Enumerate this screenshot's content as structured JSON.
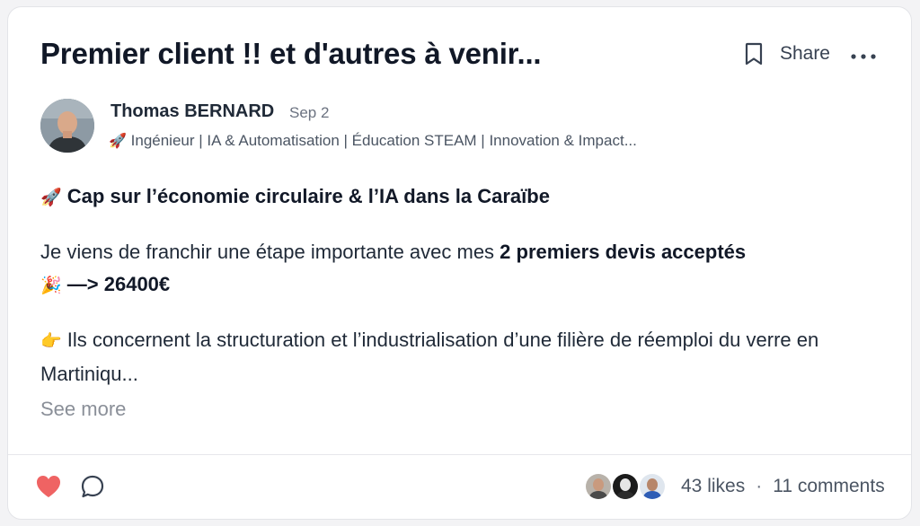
{
  "post": {
    "title": "Premier client !! et d'autres à venir...",
    "share_label": "Share",
    "author": {
      "name": "Thomas BERNARD",
      "date": "Sep 2",
      "headline_emoji": "🚀",
      "headline": " Ingénieur | IA & Automatisation | Éducation STEAM | Innovation & Impact..."
    },
    "body": {
      "p1_emoji": "🚀",
      "p1_text": " Cap sur l’économie circulaire & l’IA dans la Caraïbe",
      "p2_text": "Je viens de franchir une étape importante avec mes ",
      "p2_bold": "2 premiers devis acceptés",
      "p2_emoji": "🎉",
      "p2_bold2": " —> 26400€",
      "p3_emoji": "👉",
      "p3_text": " Ils concernent la structuration et l’industrialisation d’une filière de réemploi du verre en Martiniqu..."
    },
    "see_more": "See more",
    "footer": {
      "likes": "43 likes",
      "separator": "·",
      "comments": "11 comments"
    },
    "icons": [
      "bookmark-icon",
      "more-icon",
      "heart-icon",
      "comment-icon"
    ],
    "colors": {
      "heart": "#ef6363",
      "text": "#1f2937",
      "muted": "#8a8f98"
    }
  }
}
